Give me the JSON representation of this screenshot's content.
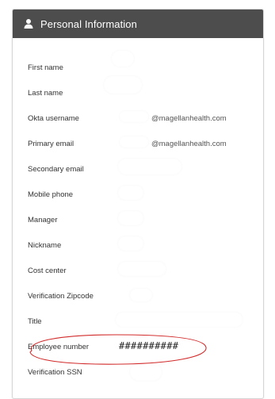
{
  "panel": {
    "title": "Personal Information",
    "icon": "user-icon"
  },
  "fields": [
    {
      "key": "first_name",
      "label": "First name",
      "value": ""
    },
    {
      "key": "last_name",
      "label": "Last name",
      "value": ""
    },
    {
      "key": "okta_username",
      "label": "Okta username",
      "value": "@magellanhealth.com"
    },
    {
      "key": "primary_email",
      "label": "Primary email",
      "value": "@magellanhealth.com"
    },
    {
      "key": "secondary_email",
      "label": "Secondary email",
      "value": ""
    },
    {
      "key": "mobile_phone",
      "label": "Mobile phone",
      "value": ""
    },
    {
      "key": "manager",
      "label": "Manager",
      "value": ""
    },
    {
      "key": "nickname",
      "label": "Nickname",
      "value": ""
    },
    {
      "key": "cost_center",
      "label": "Cost center",
      "value": ""
    },
    {
      "key": "verification_zipcode",
      "label": "Verification Zipcode",
      "value": ""
    },
    {
      "key": "title",
      "label": "Title",
      "value": ""
    },
    {
      "key": "employee_number",
      "label": "Employee number",
      "value": "##########"
    },
    {
      "key": "verification_ssn",
      "label": "Verification SSN",
      "value": ""
    }
  ],
  "annotation": {
    "highlight_color": "#d22b2b",
    "highlighted_field": "Employee number"
  }
}
